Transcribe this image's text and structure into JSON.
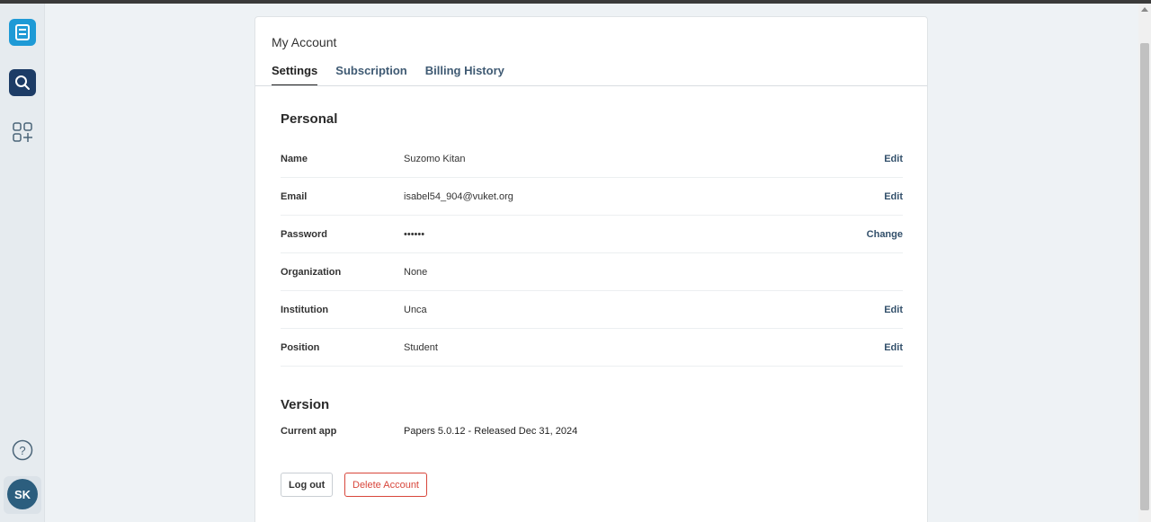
{
  "sidebar": {
    "avatar_initials": "SK",
    "icons": [
      "library-icon",
      "search-icon",
      "addons-icon",
      "help-icon"
    ]
  },
  "account": {
    "title": "My Account",
    "tabs": [
      {
        "label": "Settings",
        "active": true
      },
      {
        "label": "Subscription",
        "active": false
      },
      {
        "label": "Billing History",
        "active": false
      }
    ]
  },
  "personal": {
    "title": "Personal",
    "rows": [
      {
        "label": "Name",
        "value": "Suzomo Kitan",
        "action": "Edit"
      },
      {
        "label": "Email",
        "value": "isabel54_904@vuket.org",
        "action": "Edit"
      },
      {
        "label": "Password",
        "value": "••••••",
        "action": "Change"
      },
      {
        "label": "Organization",
        "value": "None",
        "action": ""
      },
      {
        "label": "Institution",
        "value": "Unca",
        "action": "Edit"
      },
      {
        "label": "Position",
        "value": "Student",
        "action": "Edit"
      }
    ]
  },
  "version": {
    "title": "Version",
    "label": "Current app",
    "value": "Papers 5.0.12 - Released Dec 31, 2024"
  },
  "buttons": {
    "logout": "Log out",
    "delete": "Delete Account"
  },
  "colors": {
    "accent": "#1e9ad6",
    "navy": "#1d3c66",
    "danger": "#d8463b"
  }
}
